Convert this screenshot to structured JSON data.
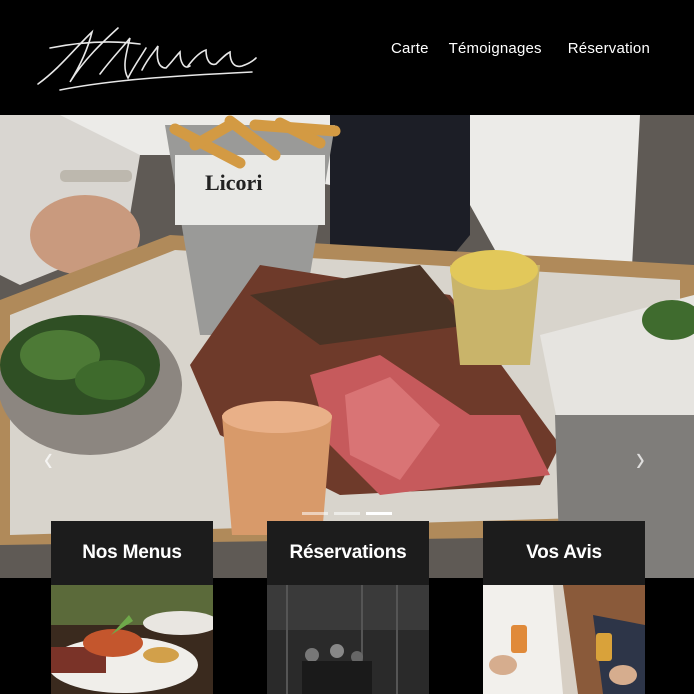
{
  "header": {
    "logo_alt": "Jefferson signature logo",
    "nav": [
      {
        "label": "Carte"
      },
      {
        "label": "Témoignages"
      },
      {
        "label": "Réservation"
      }
    ]
  },
  "hero": {
    "icon_prev": "chevron-left-icon",
    "icon_next": "chevron-right-icon",
    "prev_glyph": "‹",
    "next_glyph": "›",
    "slide_count": 3,
    "active_slide": 3
  },
  "cards": [
    {
      "title": "Nos Menus"
    },
    {
      "title": "Réservations"
    },
    {
      "title": "Vos Avis"
    }
  ],
  "colors": {
    "background": "#000000",
    "card_header": "#1c1c1c",
    "text": "#ffffff"
  }
}
